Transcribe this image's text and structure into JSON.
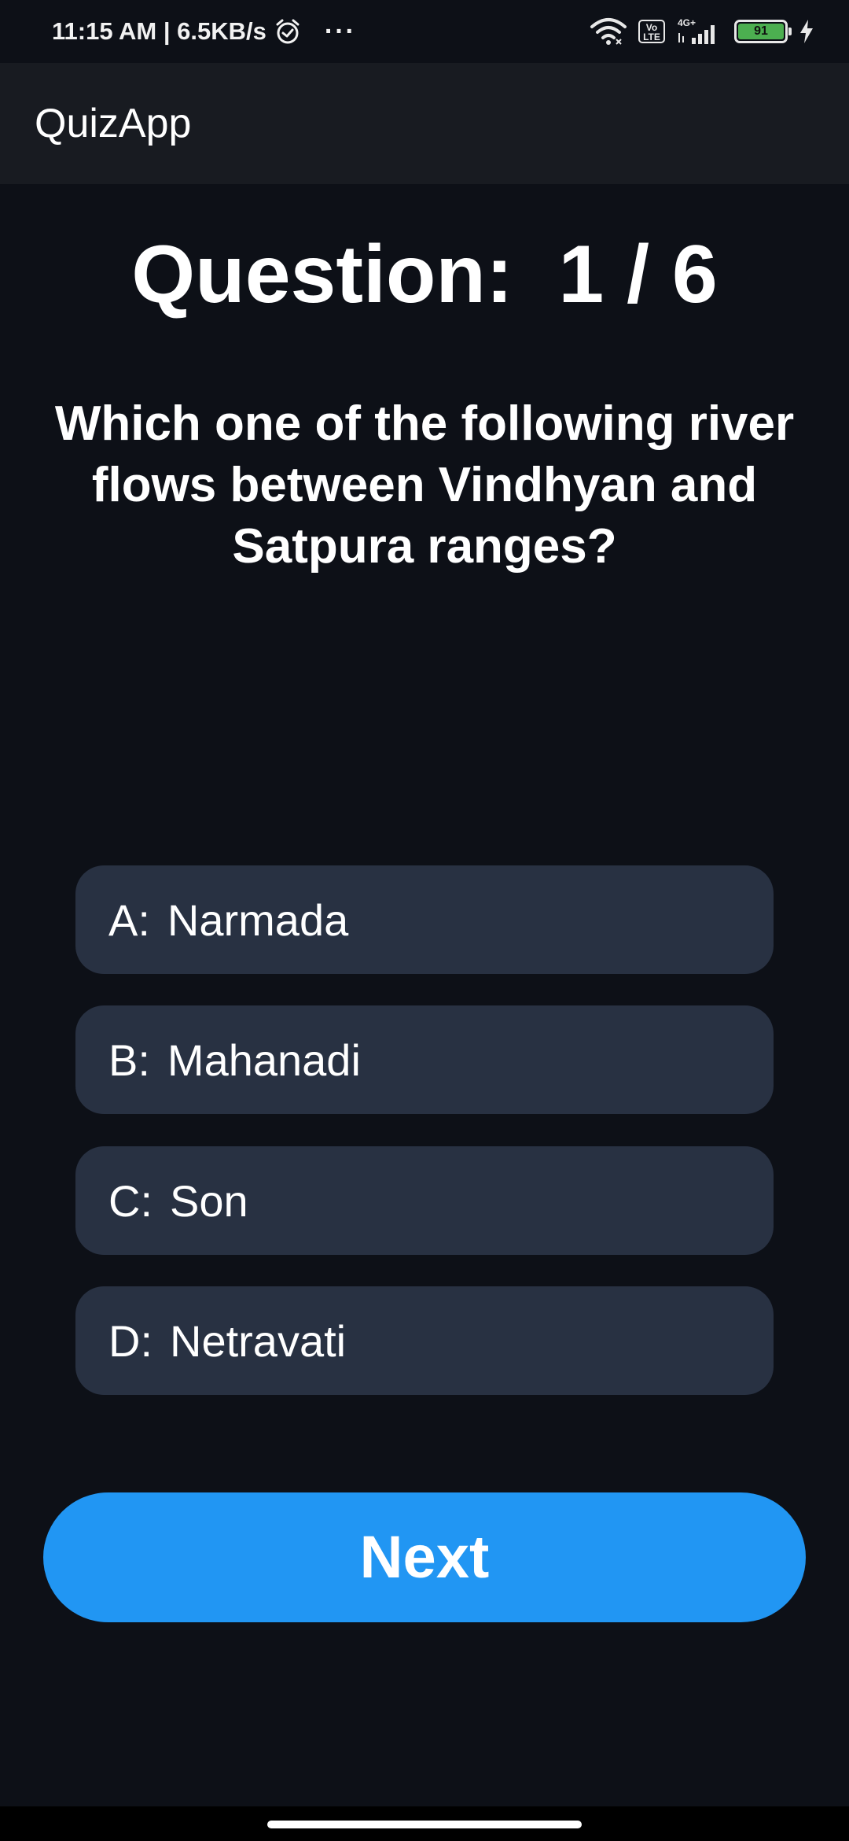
{
  "status_bar": {
    "time_speed": "11:15 AM | 6.5KB/s",
    "more": "···",
    "volte": "Vo LTE",
    "network": "4G+",
    "battery": "91"
  },
  "app_bar": {
    "title": "QuizApp"
  },
  "question": {
    "counter": "Question:  1 / 6",
    "progress": {
      "current": 1,
      "total": 6
    },
    "text": "Which one of the following river flows between Vindhyan and Satpura ranges?"
  },
  "options": [
    {
      "letter": "A:",
      "text": "Narmada"
    },
    {
      "letter": "B:",
      "text": "Mahanadi"
    },
    {
      "letter": "C:",
      "text": "Son"
    },
    {
      "letter": "D:",
      "text": "Netravati"
    }
  ],
  "next_button": {
    "label": "Next"
  },
  "colors": {
    "background": "#0d1017",
    "app_bar": "#181b21",
    "option_bg": "#283142",
    "accent": "#2196f3",
    "battery": "#4caf50"
  }
}
